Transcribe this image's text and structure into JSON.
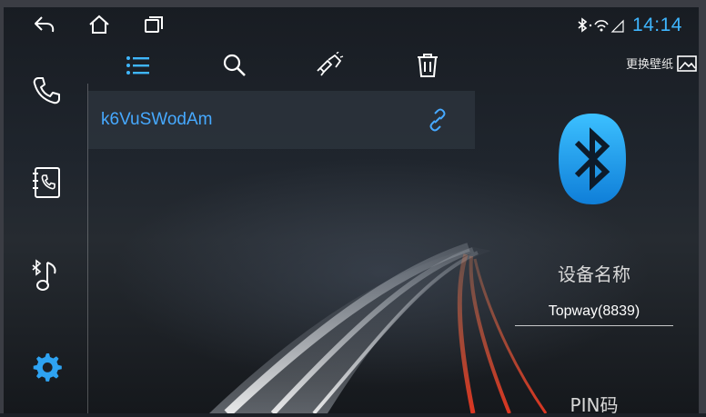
{
  "status": {
    "time": "14:14"
  },
  "header": {
    "wallpaper_label": "更换壁纸"
  },
  "devices": [
    {
      "name": "k6VuSWodAm"
    }
  ],
  "panel": {
    "device_name_label": "设备名称",
    "device_name_value": "Topway(8839)",
    "pin_label": "PIN码"
  },
  "colors": {
    "accent": "#3fb6ff",
    "device_text": "#46a9ff",
    "bt_badge": "#1f9ae8"
  },
  "icons": {
    "back": "back-icon",
    "home": "home-icon",
    "recent": "recent-apps-icon",
    "phone": "phone-icon",
    "contacts": "contacts-icon",
    "music": "bluetooth-music-icon",
    "settings": "gear-icon",
    "list": "list-icon",
    "search": "search-icon",
    "pair": "pair-icon",
    "delete": "trash-icon",
    "wallpaper": "image-icon",
    "link": "link-icon"
  }
}
